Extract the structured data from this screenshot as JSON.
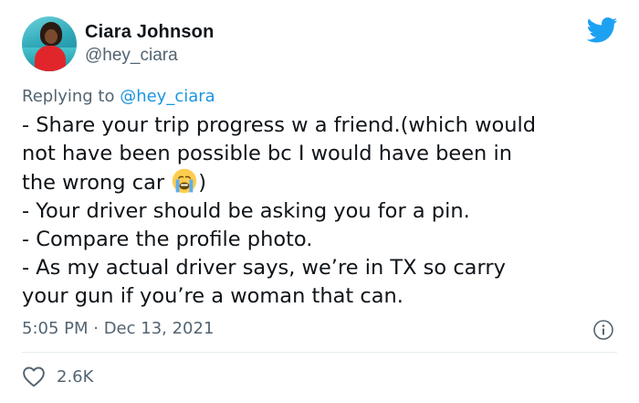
{
  "author": {
    "name": "Ciara Johnson",
    "handle": "@hey_ciara"
  },
  "reply": {
    "prefix": "Replying to ",
    "mention": "@hey_ciara"
  },
  "body": {
    "line1": "- Share your trip progress w a friend.(which would",
    "line2": "not have been possible bc I would have been in",
    "line3_before_emoji": "the wrong car ",
    "line3_after_emoji": ")",
    "line4": "- Your driver should be asking you for a pin.",
    "line5": "- Compare the profile photo.",
    "line6": "- As my actual driver says, we’re in TX so carry",
    "line7": "your gun if you’re a woman that can."
  },
  "meta": {
    "timestamp": "5:05 PM · Dec 13, 2021"
  },
  "actions": {
    "like_count": "2.6K"
  },
  "icons": {
    "logo": "twitter-bird-icon",
    "emoji": "loudly-crying-face-emoji",
    "info": "info-icon",
    "like": "heart-icon"
  },
  "colors": {
    "twitter_blue": "#1da1f2",
    "mention_blue": "#1b95e0",
    "secondary_text": "#536471",
    "primary_text": "#0f1419"
  }
}
